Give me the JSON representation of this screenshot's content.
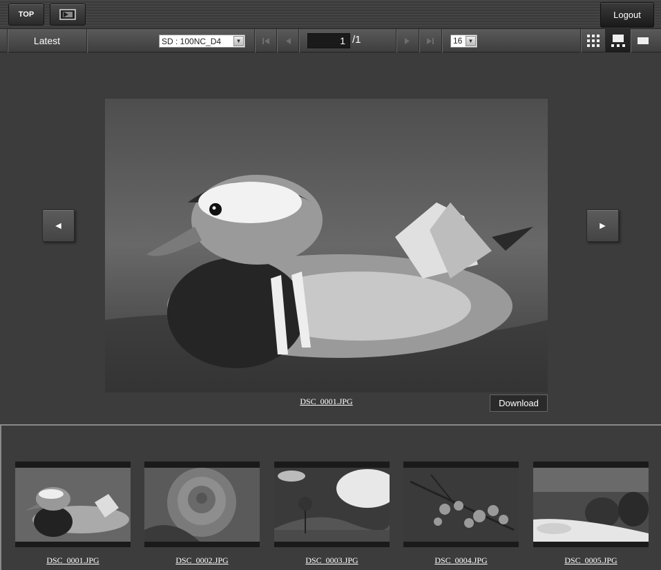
{
  "header": {
    "top_label": "TOP",
    "logout_label": "Logout"
  },
  "toolbar": {
    "latest_label": "Latest",
    "card_select": "SD : 100NC_D4",
    "page_current": "1",
    "page_total": "/1",
    "per_page": "16"
  },
  "viewer": {
    "filename": "DSC_0001.JPG",
    "download_label": "Download"
  },
  "thumbnails": [
    {
      "name": "DSC_0001.JPG"
    },
    {
      "name": "DSC_0002.JPG"
    },
    {
      "name": "DSC_0003.JPG"
    },
    {
      "name": "DSC_0004.JPG"
    },
    {
      "name": "DSC_0005.JPG"
    }
  ]
}
